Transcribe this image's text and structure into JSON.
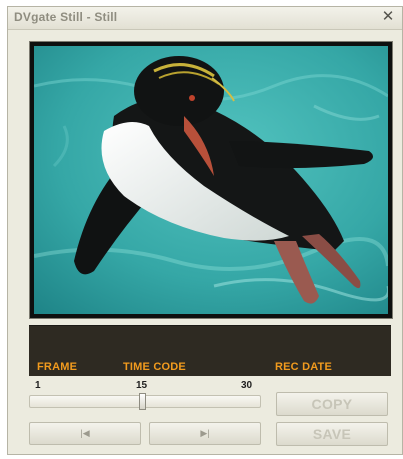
{
  "window": {
    "title": "DVgate Still - Still",
    "close_glyph": "✕"
  },
  "info": {
    "frame_label": "FRAME",
    "timecode_label": "TIME CODE",
    "recdate_label": "REC DATE"
  },
  "slider": {
    "min_label": "1",
    "mid_label": "15",
    "max_label": "30",
    "min": 1,
    "max": 30,
    "value": 15
  },
  "buttons": {
    "prev_icon": "|◀",
    "next_icon": "▶|",
    "copy_label": "COPY",
    "save_label": "SAVE"
  },
  "icons": {
    "prev": "skip-previous-icon",
    "next": "skip-next-icon",
    "close": "close-icon"
  },
  "colors": {
    "label_orange": "#f29b1e",
    "panel_dark": "#2e2a22",
    "water": "#3fb3b0"
  }
}
